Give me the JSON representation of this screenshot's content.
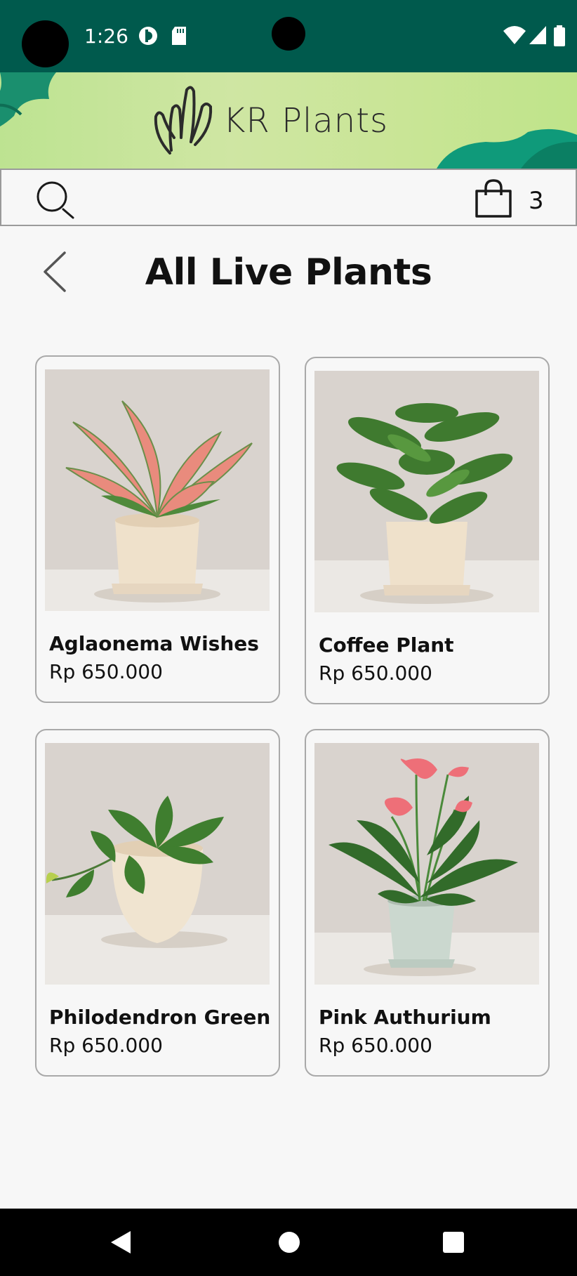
{
  "status_bar": {
    "time": "1:26",
    "icons": [
      "data-saver-icon",
      "sd-card-icon",
      "wifi-icon",
      "signal-icon",
      "battery-icon"
    ]
  },
  "banner": {
    "brand": "KR Plants",
    "colors": {
      "leaf_dark": "#1a8f6e",
      "leaf_teal": "#0f9a7a",
      "banner_green": "#c9e596"
    }
  },
  "topbar": {
    "search_icon": "search-icon",
    "cart_icon": "shopping-bag-icon",
    "cart_count": "3"
  },
  "header": {
    "back_icon": "chevron-left-icon",
    "title": "All Live Plants"
  },
  "products": [
    {
      "name": "Aglaonema Wishes",
      "price": "Rp 650.000"
    },
    {
      "name": "Coffee Plant",
      "price": "Rp 650.000"
    },
    {
      "name": "Philodendron Green",
      "price": "Rp 650.000"
    },
    {
      "name": "Pink Authurium",
      "price": "Rp 650.000"
    }
  ],
  "nav_bar": {
    "buttons": [
      "back-triangle-icon",
      "home-circle-icon",
      "recents-square-icon"
    ]
  },
  "colors": {
    "status_bar": "#005a4d",
    "background": "#f7f7f7",
    "card_border": "#a9a9a9"
  }
}
